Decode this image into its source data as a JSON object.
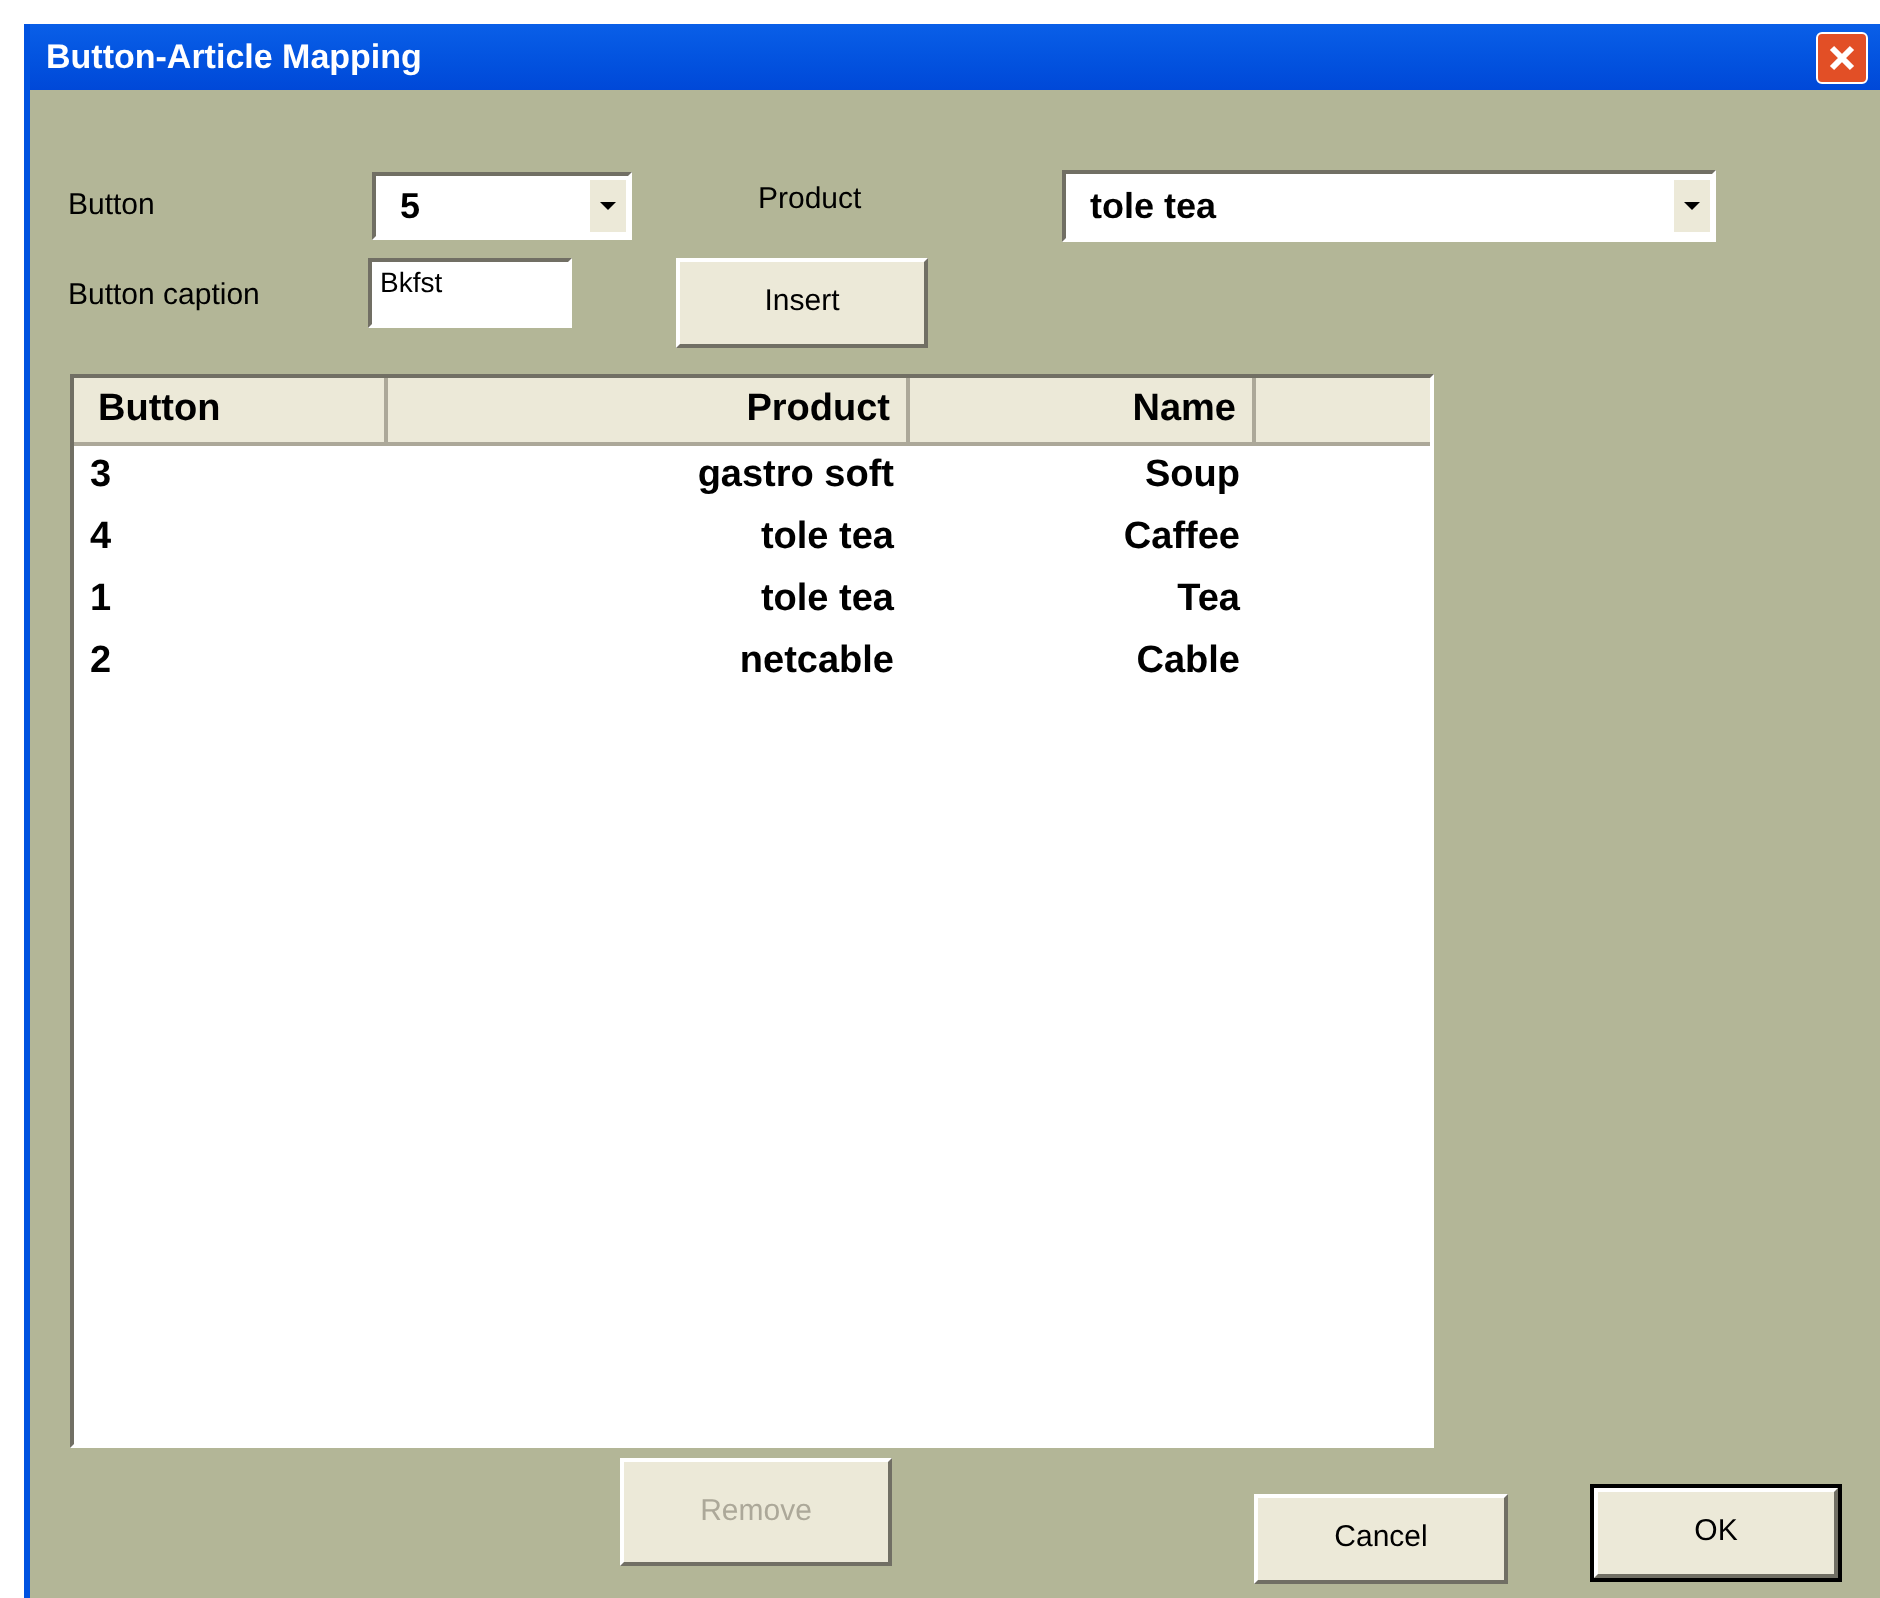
{
  "window": {
    "title": "Button-Article Mapping"
  },
  "button_field": {
    "label": "Button",
    "value": "5"
  },
  "product_field": {
    "label": "Product",
    "value": "tole tea"
  },
  "caption_field": {
    "label": "Button caption",
    "value": "Bkfst"
  },
  "insert_button": {
    "label": "Insert",
    "disabled": false
  },
  "table": {
    "columns": [
      "Button",
      "Product",
      "Name"
    ],
    "rows": [
      {
        "button": "3",
        "product": "gastro soft",
        "name": "Soup"
      },
      {
        "button": "4",
        "product": "tole tea",
        "name": "Caffee"
      },
      {
        "button": "1",
        "product": "tole tea",
        "name": "Tea"
      },
      {
        "button": "2",
        "product": "netcable",
        "name": "Cable"
      }
    ]
  },
  "remove_button": {
    "label": "Remove",
    "disabled": true
  },
  "cancel_button": {
    "label": "Cancel",
    "disabled": false
  },
  "ok_button": {
    "label": "OK",
    "disabled": false,
    "default": true
  }
}
